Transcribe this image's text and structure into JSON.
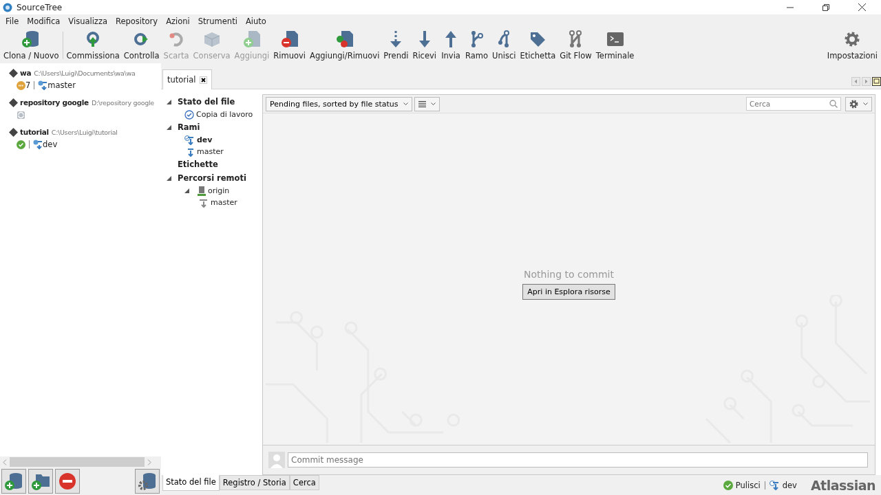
{
  "window": {
    "title": "SourceTree"
  },
  "menu": [
    "File",
    "Modifica",
    "Visualizza",
    "Repository",
    "Azioni",
    "Strumenti",
    "Aiuto"
  ],
  "toolbar": [
    {
      "label": "Clona / Nuovo",
      "kind": "clone",
      "disabled": false
    },
    {
      "label": "Commissiona",
      "kind": "commit",
      "disabled": false
    },
    {
      "label": "Controlla",
      "kind": "checkout",
      "disabled": false
    },
    {
      "label": "Scarta",
      "kind": "discard",
      "disabled": true
    },
    {
      "label": "Conserva",
      "kind": "stash",
      "disabled": true
    },
    {
      "label": "Aggiungi",
      "kind": "add",
      "disabled": true
    },
    {
      "label": "Rimuovi",
      "kind": "remove",
      "disabled": false
    },
    {
      "label": "Aggiungi/Rimuovi",
      "kind": "addremove",
      "disabled": false
    },
    {
      "label": "Prendi",
      "kind": "fetch",
      "disabled": false
    },
    {
      "label": "Ricevi",
      "kind": "pull",
      "disabled": false
    },
    {
      "label": "Invia",
      "kind": "push",
      "disabled": false
    },
    {
      "label": "Ramo",
      "kind": "branch",
      "disabled": false
    },
    {
      "label": "Unisci",
      "kind": "merge",
      "disabled": false
    },
    {
      "label": "Etichetta",
      "kind": "tag",
      "disabled": false
    },
    {
      "label": "Git Flow",
      "kind": "gitflow",
      "disabled": false
    },
    {
      "label": "Terminale",
      "kind": "terminal",
      "disabled": false
    }
  ],
  "settings_button": "Impostazioni",
  "repositories": [
    {
      "name": "wa",
      "path": "C:\\Users\\Luigi\\Documents\\wa\\wa",
      "kind": "pending",
      "count": "7",
      "branch": "master"
    },
    {
      "name": "repository google",
      "path": "D:\\repository google",
      "kind": "syncing"
    },
    {
      "name": "tutorial",
      "path": "C:\\Users\\Luigi\\tutorial",
      "kind": "clean",
      "branch": "dev"
    }
  ],
  "tab": {
    "label": "tutorial"
  },
  "sidebar": [
    {
      "label": "Stato del file",
      "expanded": true,
      "children": [
        {
          "label": "Copia di lavoro",
          "kind": "working-copy"
        }
      ]
    },
    {
      "label": "Rami",
      "expanded": true,
      "children": [
        {
          "label": "dev",
          "kind": "branch",
          "current": true
        },
        {
          "label": "master",
          "kind": "branch",
          "current": false
        }
      ]
    },
    {
      "label": "Etichette"
    },
    {
      "label": "Percorsi remoti",
      "expanded": true,
      "children": [
        {
          "label": "origin",
          "kind": "remote",
          "children": [
            {
              "label": "master",
              "kind": "remote-branch"
            }
          ]
        }
      ]
    }
  ],
  "file_view": {
    "filter": "Pending files, sorted by file status",
    "search": {
      "placeholder": "Cerca"
    },
    "empty_message": "Nothing to commit",
    "open_button": "Apri in Esplora risorse",
    "commit": {
      "placeholder": "Commit message"
    }
  },
  "bottom_tabs": [
    {
      "label": "Stato del file",
      "selected": true
    },
    {
      "label": "Registro / Storia",
      "selected": false
    },
    {
      "label": "Cerca",
      "selected": false
    }
  ],
  "status_bar": {
    "state": "Pulisci",
    "branch": "dev",
    "logo": "Atlassian"
  }
}
